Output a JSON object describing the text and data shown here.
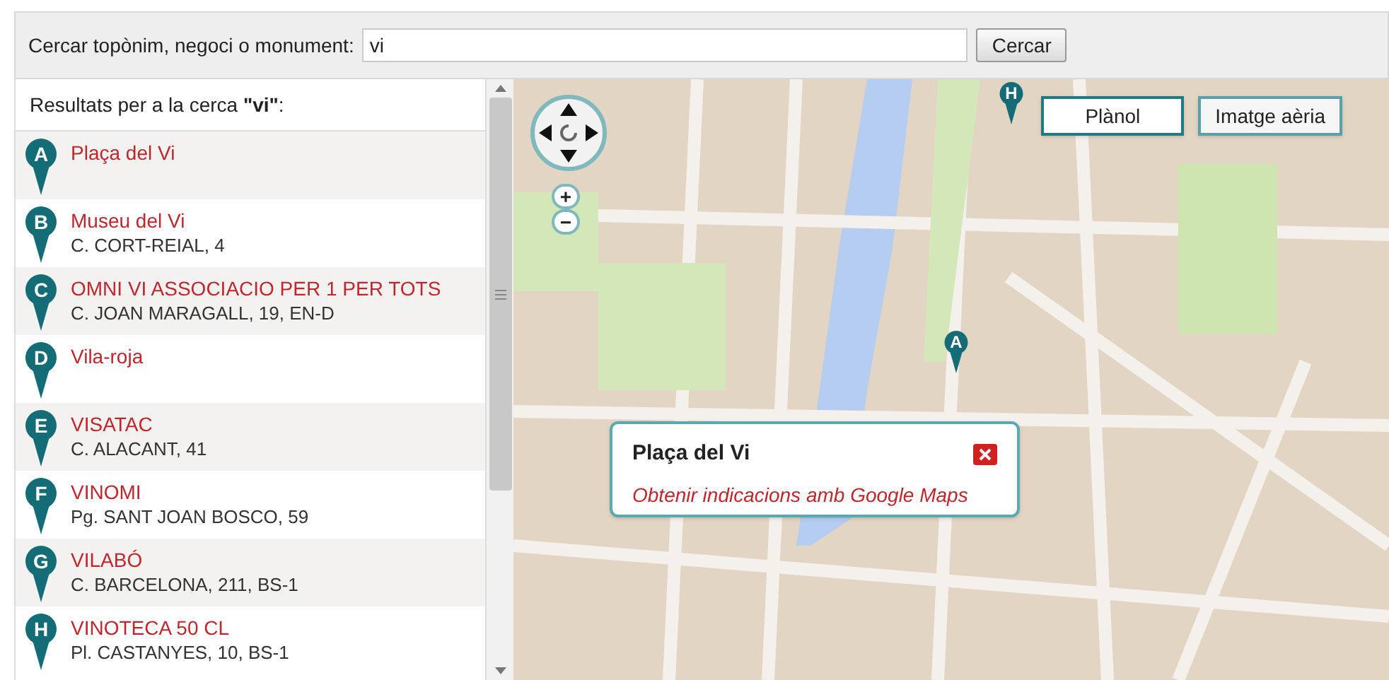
{
  "search": {
    "label": "Cercar topònim, negoci o monument:",
    "value": "vi",
    "button": "Cercar"
  },
  "results": {
    "heading_prefix": "Resultats per a la cerca ",
    "query": "\"vi\"",
    "heading_suffix": ":",
    "items": [
      {
        "letter": "A",
        "name": "Plaça del Vi"
      },
      {
        "letter": "B",
        "name": "Museu del Vi",
        "address": "C. CORT-REIAL, 4"
      },
      {
        "letter": "C",
        "name": "OMNI VI ASSOCIACIO PER 1 PER TOTS",
        "address": "C. JOAN MARAGALL, 19, EN-D"
      },
      {
        "letter": "D",
        "name": "Vila-roja"
      },
      {
        "letter": "E",
        "name": "VISATAC",
        "address": "C. ALACANT, 41"
      },
      {
        "letter": "F",
        "name": "VINOMI",
        "address": "Pg. SANT JOAN BOSCO, 59"
      },
      {
        "letter": "G",
        "name": "VILABÓ",
        "address": "C. BARCELONA, 211, BS-1"
      },
      {
        "letter": "H",
        "name": "VINOTECA 50 CL",
        "address": "Pl. CASTANYES, 10, BS-1"
      }
    ]
  },
  "map": {
    "layers": [
      {
        "label": "Plànol",
        "selected": true
      },
      {
        "label": "Imatge aèria",
        "selected": false
      }
    ],
    "zoom_in": "+",
    "zoom_out": "−",
    "markers": [
      {
        "letter": "H"
      },
      {
        "letter": "A"
      }
    ],
    "popup": {
      "title": "Plaça del Vi",
      "link": "Obtenir indicacions amb Google Maps"
    }
  }
}
